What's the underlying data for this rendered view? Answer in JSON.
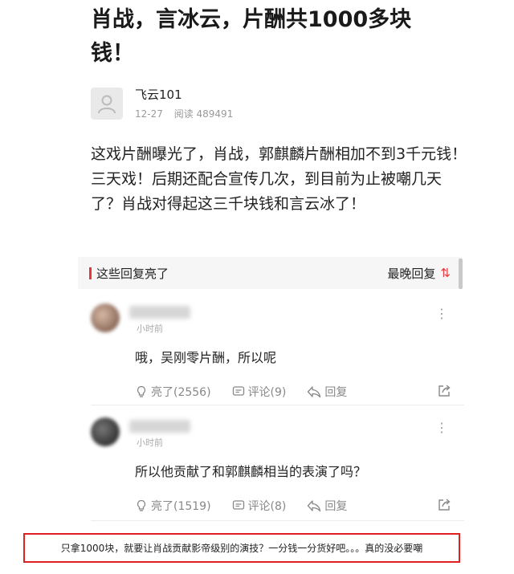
{
  "article": {
    "title": "肖战，言冰云，片酬共1000多块钱！",
    "author": {
      "name": "飞云101",
      "date": "12-27",
      "reads_label": "阅读 489491"
    },
    "body": "这戏片酬曝光了，肖战，郭麒麟片酬相加不到3千元钱！三天戏！后期还配合宣传几次，到目前为止被嘲几天了？肖战对得起这三千块钱和言云冰了！"
  },
  "replies_bar": {
    "label": "这些回复亮了",
    "sort_label": "最晚回复",
    "sort_icon": "⇅"
  },
  "comments": [
    {
      "time": "小时前",
      "text": "哦，吴刚零片酬，所以呢",
      "like_label": "亮了(2556)",
      "comment_label": "评论(9)",
      "reply_label": "回复"
    },
    {
      "time": "小时前",
      "text": "所以他贡献了和郭麒麟相当的表演了吗？",
      "like_label": "亮了(1519)",
      "comment_label": "评论(8)",
      "reply_label": "回复"
    }
  ],
  "note": "只拿1000块，就要让肖战贡献影帝级别的演技？一分钱一分货好吧。。。真的没必要嘲",
  "colors": {
    "accent": "#e8373c",
    "note_border": "#e02020"
  }
}
